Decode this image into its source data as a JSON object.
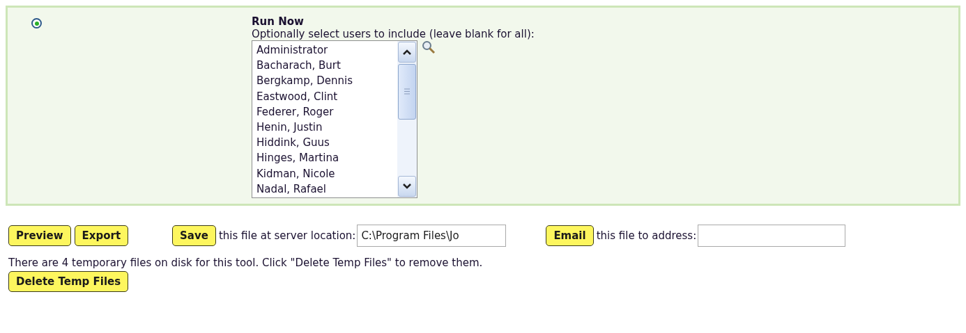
{
  "run_option": {
    "selected": true,
    "title": "Run Now",
    "hint": "Optionally select users to include (leave blank for all):",
    "users": [
      "Administrator",
      "Bacharach, Burt",
      "Bergkamp, Dennis",
      "Eastwood, Clint",
      "Federer, Roger",
      "Henin, Justin",
      "Hiddink, Guus",
      "Hinges, Martina",
      "Kidman, Nicole",
      "Nadal, Rafael"
    ]
  },
  "actions": {
    "preview": "Preview",
    "export": "Export",
    "save": "Save",
    "save_label": "this file at server location:",
    "save_path": "C:\\Program Files\\Jo",
    "email": "Email",
    "email_label": "this file to address:"
  },
  "temp_notice": "There are 4 temporary files on disk for this tool. Click \"Delete Temp Files\" to remove them.",
  "delete_button": "Delete Temp Files"
}
